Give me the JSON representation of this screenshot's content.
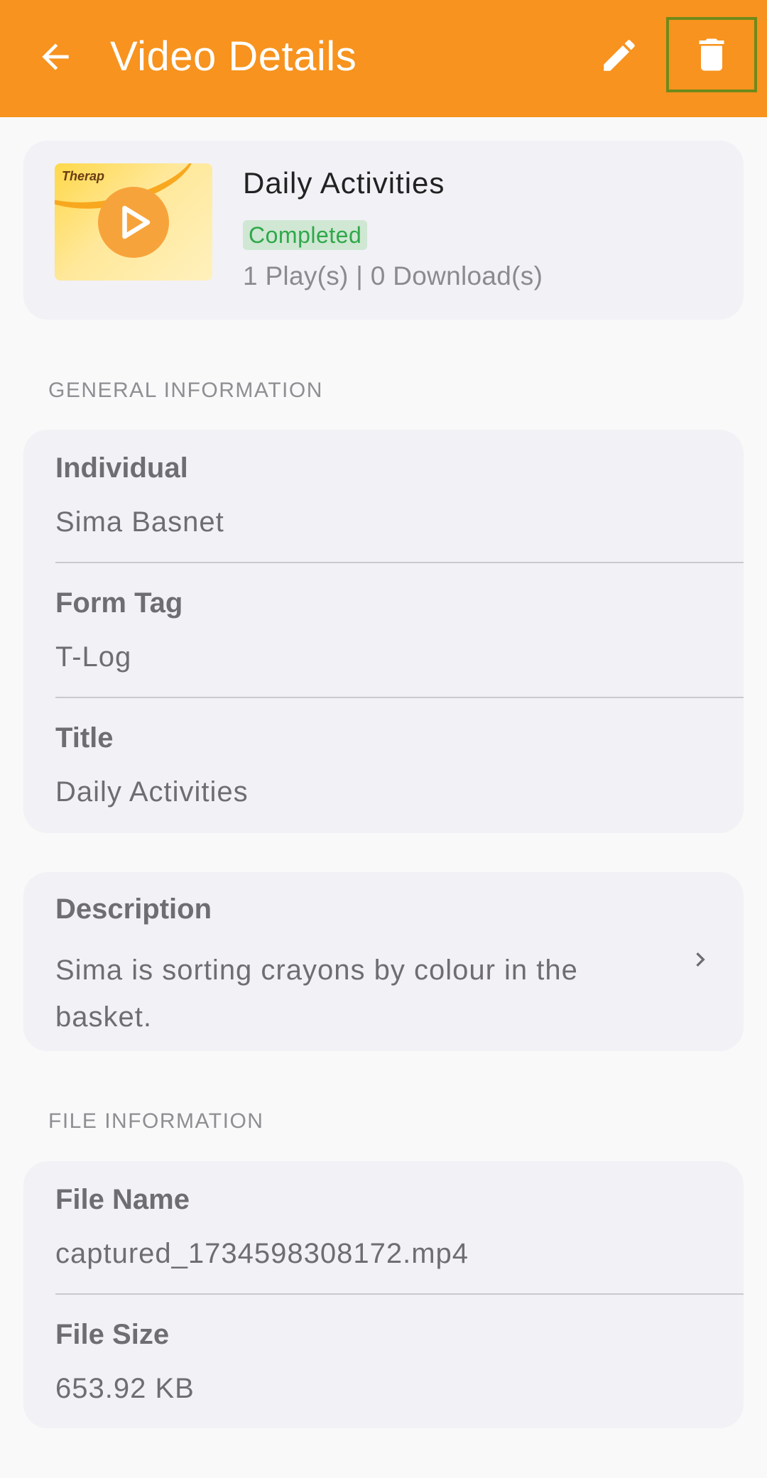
{
  "appbar": {
    "title": "Video Details",
    "back_icon": "arrow-back-icon",
    "edit_icon": "pencil-icon",
    "delete_icon": "trash-icon",
    "color": "#f7931e"
  },
  "video": {
    "title": "Daily Activities",
    "status": "Completed",
    "counts": "1 Play(s) | 0 Download(s)",
    "thumbnail_logo": "Therap"
  },
  "general": {
    "section_title": "GENERAL INFORMATION",
    "individual_label": "Individual",
    "individual_value": "Sima Basnet",
    "form_tag_label": "Form Tag",
    "form_tag_value": "T-Log",
    "title_label": "Title",
    "title_value": "Daily Activities"
  },
  "description": {
    "label": "Description",
    "value": "Sima is sorting crayons by colour in the basket."
  },
  "file": {
    "section_title": "FILE INFORMATION",
    "name_label": "File Name",
    "name_value": "captured_1734598308172.mp4",
    "size_label": "File Size",
    "size_value": "653.92 KB"
  }
}
